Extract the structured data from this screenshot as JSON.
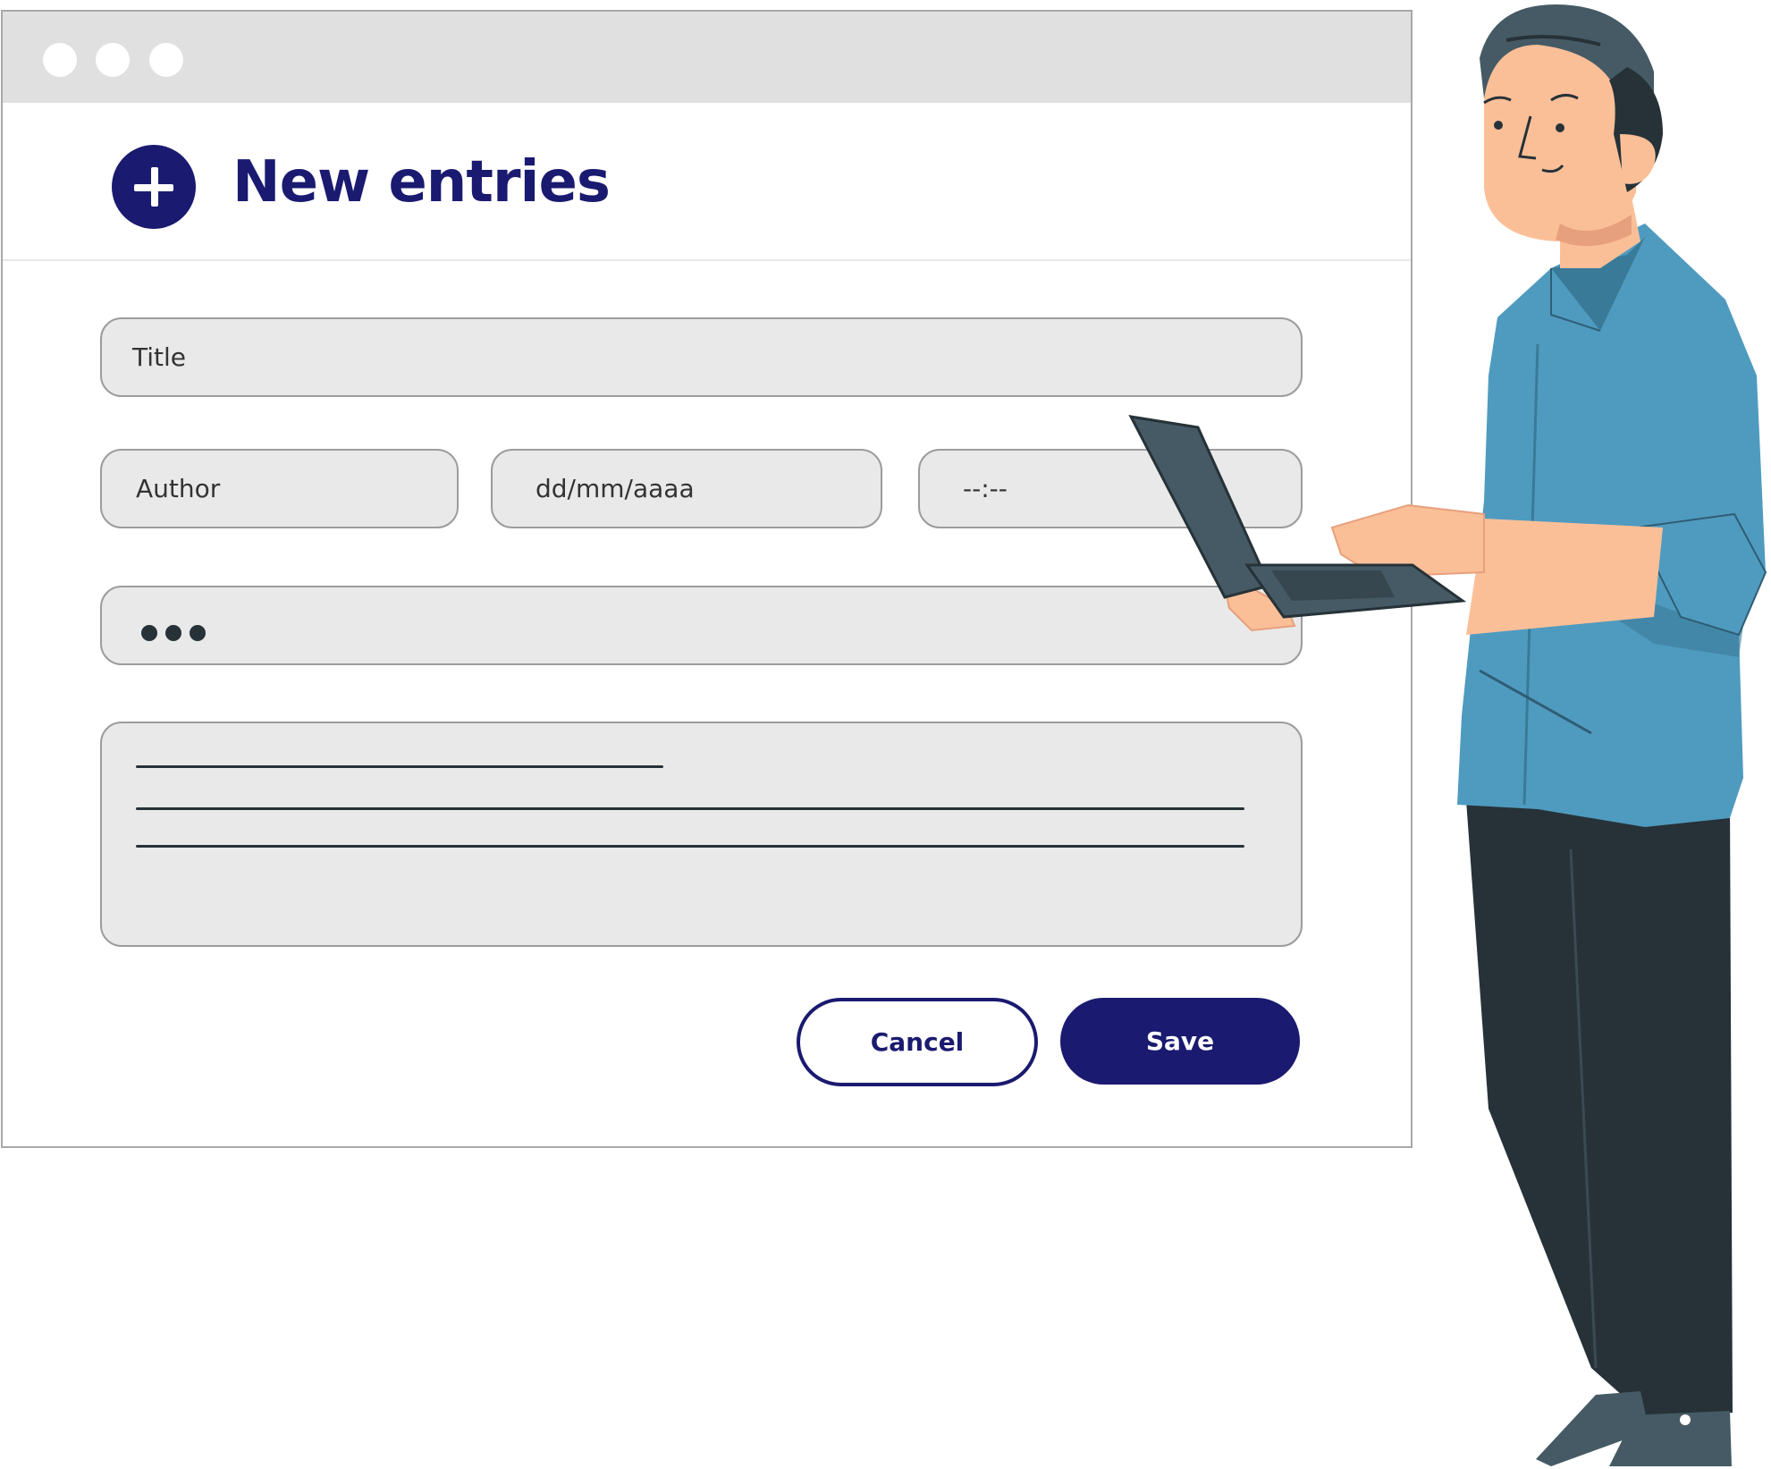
{
  "window": {
    "controls": [
      {
        "name": "window-dot-1"
      },
      {
        "name": "window-dot-2"
      },
      {
        "name": "window-dot-3"
      }
    ]
  },
  "header": {
    "icon": "plus-circle-icon",
    "title": "New entries"
  },
  "form": {
    "title_placeholder": "Title",
    "author_placeholder": "Author",
    "date_placeholder": "dd/mm/aaaa",
    "time_placeholder": "--:--",
    "password_dots": 3
  },
  "buttons": {
    "cancel_label": "Cancel",
    "save_label": "Save"
  },
  "colors": {
    "accent": "#1a1a70",
    "field_bg": "#e9e9e9",
    "titlebar_bg": "#e0e0e0",
    "shirt": "#4f9bbf",
    "pants": "#263238",
    "skin": "#fbbf98"
  }
}
